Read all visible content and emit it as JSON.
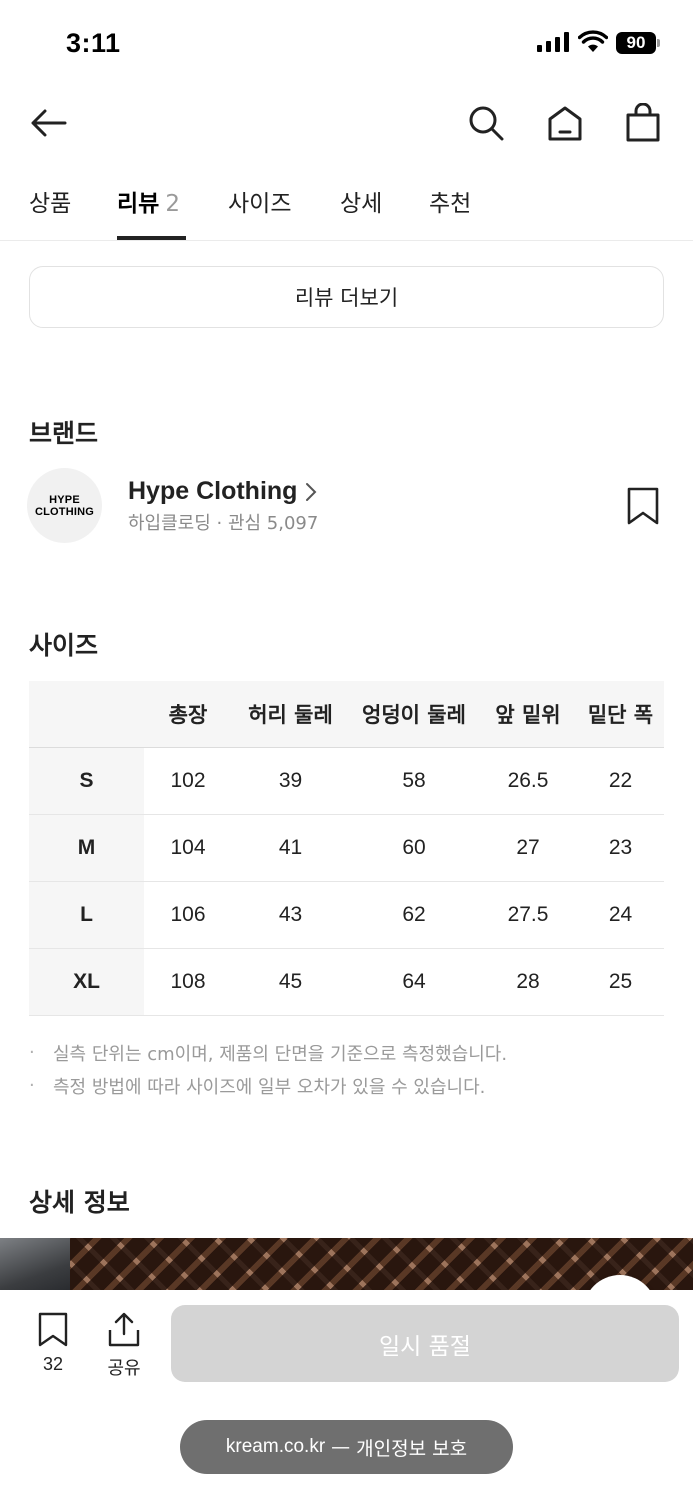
{
  "status_bar": {
    "time": "3:11",
    "battery": "90"
  },
  "nav": {
    "icons": [
      "back-arrow-icon",
      "search-icon",
      "home-icon",
      "shopping-bag-icon"
    ]
  },
  "tabs": [
    {
      "label": "상품"
    },
    {
      "label": "리뷰",
      "count": "2",
      "active": true
    },
    {
      "label": "사이즈"
    },
    {
      "label": "상세"
    },
    {
      "label": "추천"
    }
  ],
  "reviews": {
    "more_label": "리뷰 더보기"
  },
  "brand": {
    "section_title": "브랜드",
    "logo_line1": "HYPE",
    "logo_line2": "CLOTHING",
    "name": "Hype Clothing",
    "subtitle": "하입클로딩 · 관심 5,097"
  },
  "size": {
    "section_title": "사이즈",
    "headers": [
      "",
      "총장",
      "허리 둘레",
      "엉덩이 둘레",
      "앞 밑위",
      "밑단 폭"
    ],
    "rows": [
      [
        "S",
        "102",
        "39",
        "58",
        "26.5",
        "22"
      ],
      [
        "M",
        "104",
        "41",
        "60",
        "27",
        "23"
      ],
      [
        "L",
        "106",
        "43",
        "62",
        "27.5",
        "24"
      ],
      [
        "XL",
        "108",
        "45",
        "64",
        "28",
        "25"
      ]
    ],
    "notes": [
      "실측 단위는 cm이며, 제품의 단면을 기준으로 측정했습니다.",
      "측정 방법에 따라 사이즈에 일부 오차가 있을 수 있습니다."
    ]
  },
  "detail": {
    "section_title": "상세 정보"
  },
  "bottom_bar": {
    "bookmark_count": "32",
    "share_label": "공유",
    "soldout_label": "일시 품절"
  },
  "browser": {
    "domain": "kream.co.kr",
    "separator": "—",
    "privacy_label": "개인정보 보호"
  },
  "colors": {
    "accent": "#222222",
    "muted": "#9a9a9a",
    "disabled_button": "#d4d4d4"
  }
}
